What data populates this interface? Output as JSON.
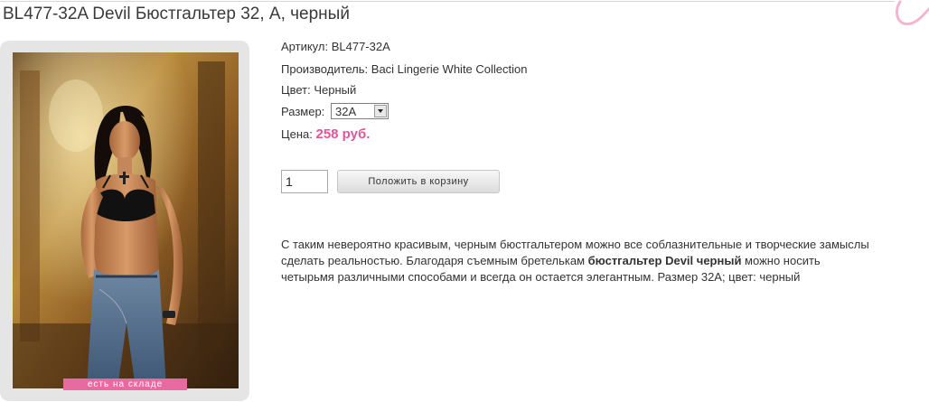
{
  "product": {
    "title": "BL477-32A Devil Бюстгальтер 32, A, черный",
    "stock_label": "есть на складе",
    "article_label": "Артикул: ",
    "article": "BL477-32A",
    "manufacturer_label": "Производитель: ",
    "manufacturer": "Baci Lingerie White Collection",
    "color_label": "Цвет: ",
    "color": "Черный",
    "size_label": "Размер:",
    "size_selected": "32A",
    "price_label": "Цена: ",
    "price": "258 руб.",
    "quantity": "1",
    "add_to_cart_label": "Положить в корзину"
  },
  "description": {
    "line1": "С таким невероятно красивым, черным бюстгальтером можно все соблазнительные и творческие замыслы",
    "line2_a": "сделать реальностью. Благодаря съемным бретелькам ",
    "line2_bold": "бюстгальтер Devil черный",
    "line2_b": " можно носить",
    "line3": "четырьмя различными способами и всегда он остается элегантным. Размер 32A; цвет: черный"
  },
  "colors": {
    "accent_pink": "#e5539a",
    "stock_badge": "#e96aa0"
  },
  "icons": {
    "dropdown": "triangle-down",
    "decor": "pink-swirl"
  }
}
